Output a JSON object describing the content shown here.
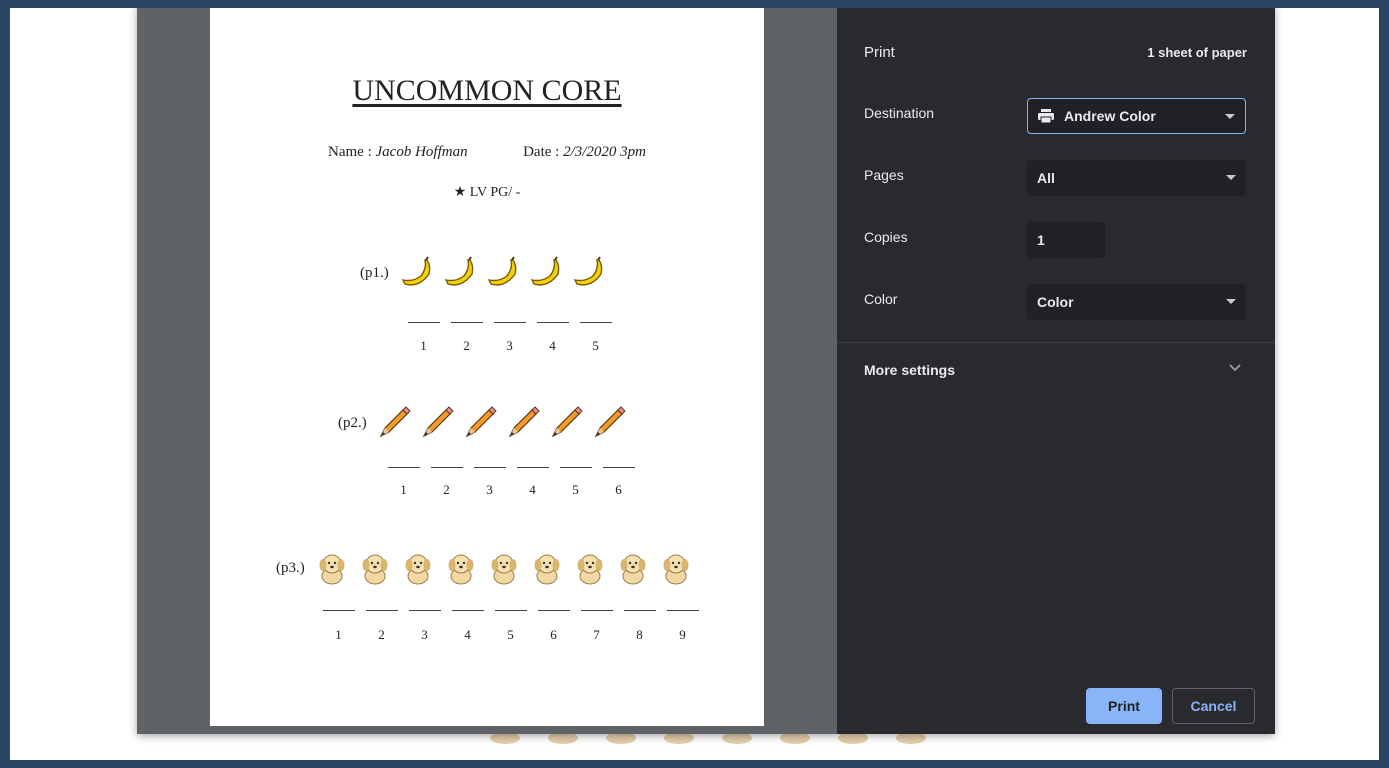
{
  "worksheet": {
    "title": "UNCOMMON CORE",
    "name_label": "Name :",
    "name_value": "Jacob Hoffman",
    "date_label": "Date :",
    "date_value": "2/3/2020 3pm",
    "level_line": "★ LV PG/ -",
    "problems": [
      {
        "label": "(p1.)",
        "icon": "banana-icon",
        "count": 5,
        "numbers": [
          "1",
          "2",
          "3",
          "4",
          "5"
        ]
      },
      {
        "label": "(p2.)",
        "icon": "pencil-icon",
        "count": 6,
        "numbers": [
          "1",
          "2",
          "3",
          "4",
          "5",
          "6"
        ]
      },
      {
        "label": "(p3.)",
        "icon": "puppy-icon",
        "count": 9,
        "numbers": [
          "1",
          "2",
          "3",
          "4",
          "5",
          "6",
          "7",
          "8",
          "9"
        ]
      }
    ]
  },
  "print_panel": {
    "title": "Print",
    "sheet_count": "1 sheet of paper",
    "destination_label": "Destination",
    "destination_value": "Andrew Color",
    "pages_label": "Pages",
    "pages_value": "All",
    "copies_label": "Copies",
    "copies_value": "1",
    "color_label": "Color",
    "color_value": "Color",
    "more_settings": "More settings",
    "print_button": "Print",
    "cancel_button": "Cancel"
  },
  "colors": {
    "panel_bg": "#292a2d",
    "accent": "#8ab4f8",
    "frame": "#2a4566"
  }
}
